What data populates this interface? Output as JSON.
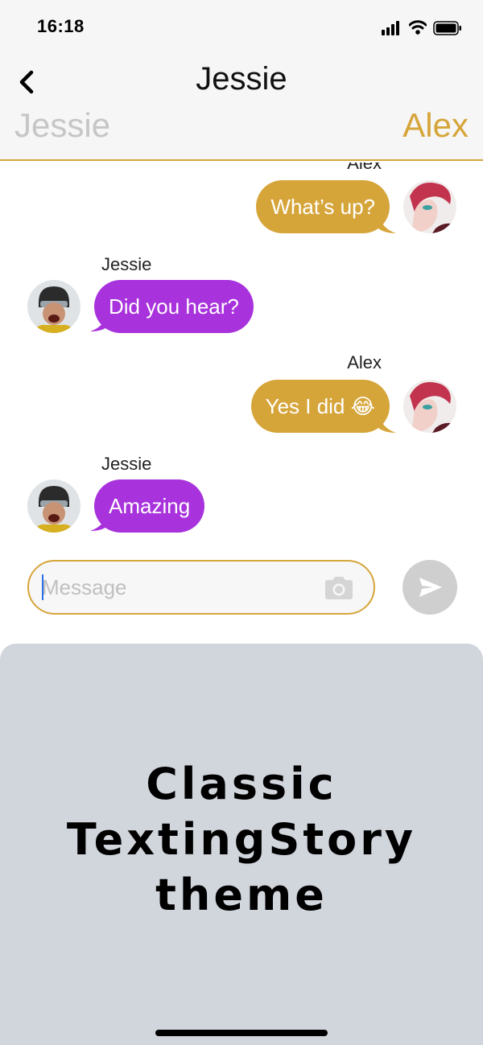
{
  "status_bar": {
    "time": "16:18"
  },
  "header": {
    "title": "Jessie",
    "sender_left": "Jessie",
    "sender_right": "Alex"
  },
  "messages": [
    {
      "sender": "Alex",
      "text": "What’s up?"
    },
    {
      "sender": "Jessie",
      "text": "Did you hear?"
    },
    {
      "sender": "Alex",
      "text": "Yes I did 😂"
    },
    {
      "sender": "Jessie",
      "text": "Amazing"
    }
  ],
  "composer": {
    "placeholder": "Message",
    "value": ""
  },
  "theme_panel": {
    "title_lines": [
      "Classic",
      "TextingStory",
      "theme"
    ]
  },
  "colors": {
    "alex_accent": "#d6a53a",
    "jessie_bubble": "#a832dc",
    "inactive_sender": "#c6c6c6",
    "panel_bg": "#d1d5dc"
  },
  "icons": {
    "back": "chevron-left-icon",
    "camera": "camera-icon",
    "send": "paper-plane-icon"
  }
}
